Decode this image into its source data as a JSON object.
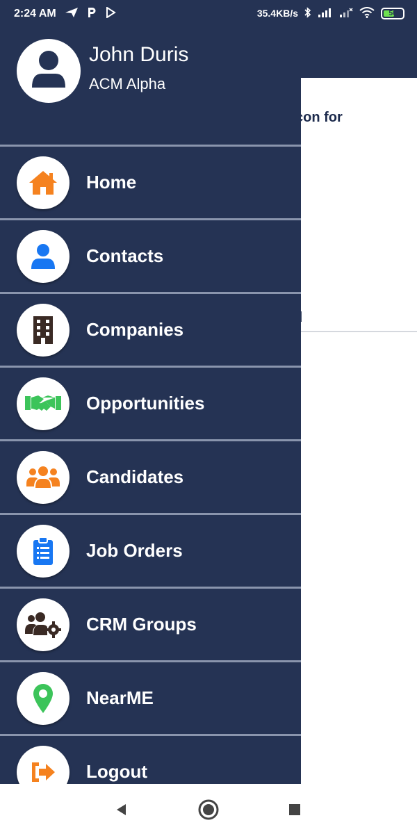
{
  "status_bar": {
    "time": "2:24 AM",
    "left_icons": [
      "navigation-icon",
      "parking-icon",
      "play-icon"
    ],
    "network_speed": "35.4KB/s",
    "right_icons": [
      "bluetooth-icon",
      "signal-icon",
      "wifi-icon"
    ],
    "battery": {
      "level": "56",
      "fraction": 0.56,
      "color": "#6ee04f"
    }
  },
  "background_screen": {
    "text_fragment_1": "rger Icon for",
    "text_fragment_2": "d"
  },
  "drawer": {
    "user": {
      "name": "John Duris",
      "organization": "ACM Alpha",
      "avatar_icon": "user-icon"
    },
    "items": [
      {
        "label": "Home",
        "icon": "home-icon",
        "color": "#f5821f"
      },
      {
        "label": "Contacts",
        "icon": "person-icon",
        "color": "#1877f2"
      },
      {
        "label": "Companies",
        "icon": "building-icon",
        "color": "#3a2a24"
      },
      {
        "label": "Opportunities",
        "icon": "handshake-icon",
        "color": "#3cc45a"
      },
      {
        "label": "Candidates",
        "icon": "group-icon",
        "color": "#f5821f"
      },
      {
        "label": "Job Orders",
        "icon": "clipboard-icon",
        "color": "#1877f2"
      },
      {
        "label": "CRM Groups",
        "icon": "group-settings-icon",
        "color": "#3a2a24"
      },
      {
        "label": "NearME",
        "icon": "location-pin-icon",
        "color": "#3cc45a"
      },
      {
        "label": "Logout",
        "icon": "logout-icon",
        "color": "#f5821f"
      }
    ]
  },
  "colors": {
    "drawer_bg": "#253354",
    "divider": "#8a95ad"
  },
  "nav_bar": {
    "buttons": [
      "back-icon",
      "home-circle-icon",
      "recents-icon"
    ]
  }
}
